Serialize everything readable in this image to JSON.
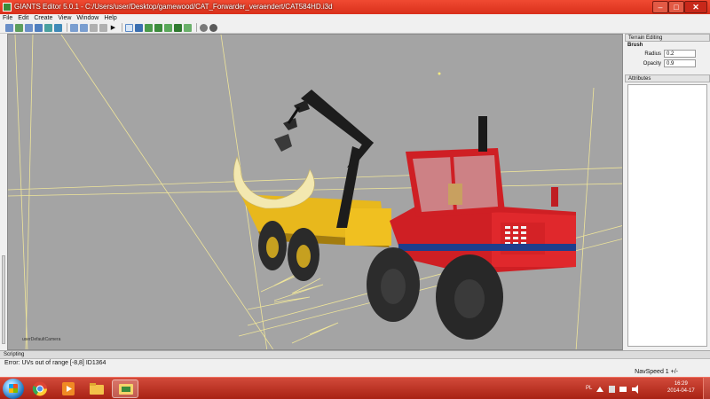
{
  "window": {
    "title": "GIANTS Editor 5.0.1 - C:/Users/user/Desktop/gamewood/CAT_Forwarder_veraendert/CAT584HD.i3d",
    "min_glyph": "–",
    "max_glyph": "□",
    "close_glyph": "✕"
  },
  "menu": [
    "File",
    "Edit",
    "Create",
    "View",
    "Window",
    "Help"
  ],
  "toolbar": {
    "icons": [
      "new-file-icon",
      "open-file-icon",
      "save-icon",
      "save-as-icon",
      "import-icon",
      "export-icon",
      "undo-icon",
      "redo-icon",
      "cut-icon",
      "copy-icon",
      "play-icon",
      "select-tool-icon",
      "move-tool-icon",
      "terrain-raise-icon",
      "terrain-lower-icon",
      "terrain-smooth-icon",
      "terrain-paint-icon",
      "foliage-paint-icon",
      "settings-icon",
      "help-icon"
    ],
    "play_glyph": "▶"
  },
  "viewport": {
    "camera_label": "userDefaultCamera"
  },
  "terrain_editing": {
    "header": "Terrain Editing",
    "brush_label": "Brush",
    "radius_label": "Radius",
    "radius_value": "0.2",
    "opacity_label": "Opacity",
    "opacity_value": "0.9"
  },
  "attributes": {
    "header": "Attributes"
  },
  "scripting": {
    "header": "Scripting",
    "error_line": "Error: UVs out of range [-8,8] ID1364"
  },
  "navspeed": "NavSpeed 1 +/-",
  "taskbar": {
    "language": "PL",
    "time": "16:29",
    "date": "2014-04-17"
  },
  "colors": {
    "accent_red": "#e8341d",
    "viewport_bg": "#a4a4a4",
    "vehicle_red": "#d8252a",
    "vehicle_yellow": "#f0c020",
    "crane_black": "#1c1c1c"
  }
}
